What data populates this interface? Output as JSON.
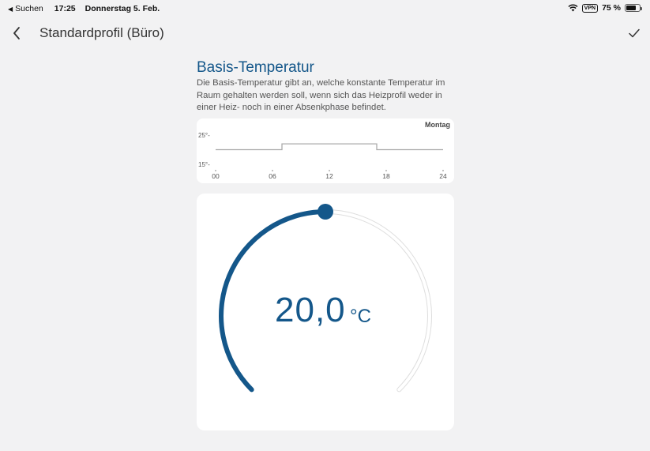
{
  "statusbar": {
    "back_label": "Suchen",
    "time": "17:25",
    "date": "Donnerstag 5. Feb.",
    "vpn": "VPN",
    "battery": "75 %",
    "battery_level": 0.75,
    "icons": [
      "wifi-icon",
      "battery-icon"
    ]
  },
  "nav": {
    "back_icon": "chevron-left-icon",
    "title": "Standardprofil (Büro)",
    "confirm_icon": "checkmark-icon"
  },
  "basis": {
    "title": "Basis-Temperatur",
    "description": "Die Basis-Temperatur gibt an, welche konstante Temperatur im Raum gehalten werden soll, wenn sich das Heizprofil weder in einer Heiz- noch in einer Absenkphase befindet."
  },
  "profile": {
    "day": "Montag",
    "y_labels": [
      "25°-",
      "15°-"
    ],
    "x_ticks": [
      "00",
      "06",
      "12",
      "18",
      "24"
    ],
    "schedule": [
      {
        "from": 0,
        "to": 7,
        "temp": 20
      },
      {
        "from": 7,
        "to": 17,
        "temp": 22
      },
      {
        "from": 17,
        "to": 24,
        "temp": 20
      }
    ]
  },
  "dial": {
    "value": "20,0",
    "unit": "°C",
    "fraction": 0.5,
    "colors": {
      "active": "#14578a",
      "track": "#e4e4e4"
    }
  }
}
